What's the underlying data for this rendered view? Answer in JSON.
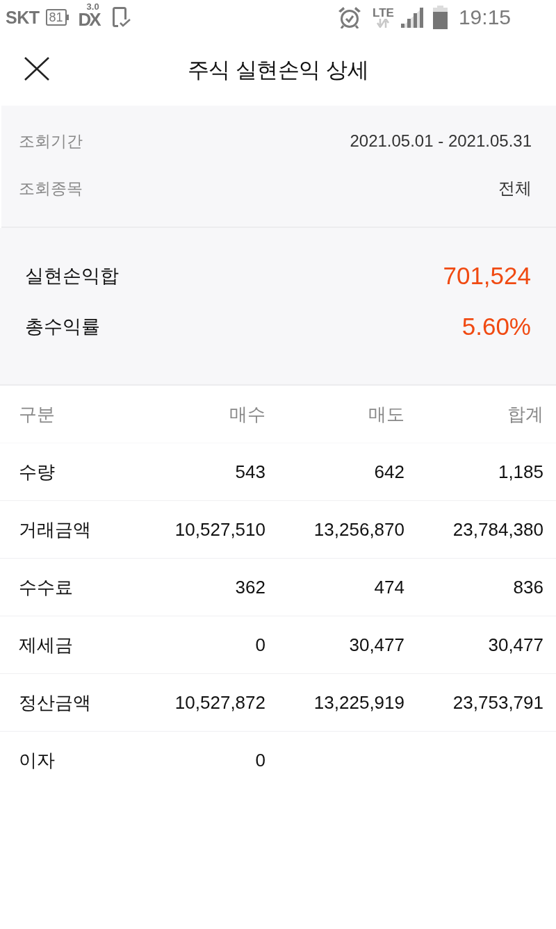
{
  "status_bar": {
    "carrier": "SKT",
    "battery_badge": "81",
    "network_logo": "DX",
    "network_version": "3.0",
    "network_type": "LTE",
    "time": "19:15"
  },
  "header": {
    "title": "주식 실현손익 상세"
  },
  "query": [
    {
      "label": "조회기간",
      "value": "2021.05.01 - 2021.05.31"
    },
    {
      "label": "조회종목",
      "value": "전체"
    }
  ],
  "summary": [
    {
      "label": "실현손익합",
      "value": "701,524"
    },
    {
      "label": "총수익률",
      "value": "5.60%"
    }
  ],
  "table": {
    "columns": [
      "구분",
      "매수",
      "매도",
      "합계"
    ],
    "rows": [
      [
        "수량",
        "543",
        "642",
        "1,185"
      ],
      [
        "거래금액",
        "10,527,510",
        "13,256,870",
        "23,784,380"
      ],
      [
        "수수료",
        "362",
        "474",
        "836"
      ],
      [
        "제세금",
        "0",
        "30,477",
        "30,477"
      ],
      [
        "정산금액",
        "10,527,872",
        "13,225,919",
        "23,753,791"
      ],
      [
        "이자",
        "0"
      ]
    ]
  }
}
